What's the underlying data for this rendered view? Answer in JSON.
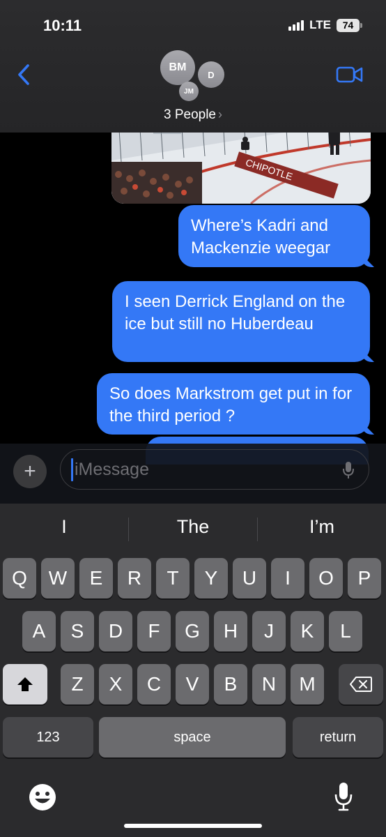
{
  "status_bar": {
    "time": "10:11",
    "network": "LTE",
    "battery": "74"
  },
  "header": {
    "avatars": [
      "BM",
      "D",
      "JM"
    ],
    "title": "3 People"
  },
  "messages": [
    {
      "text": "Where’s Kadri and Mackenzie weegar"
    },
    {
      "text": "I seen Derrick England on the ice but still no Huberdeau"
    },
    {
      "text": "So does Markstrom get put in for the third period ?"
    },
    {
      "text": ""
    }
  ],
  "photo": {
    "board_text": "CHIPOTLE"
  },
  "composer": {
    "placeholder": "iMessage",
    "plus": "+"
  },
  "keyboard": {
    "suggestions": [
      "I",
      "The",
      "I’m"
    ],
    "row1": [
      "Q",
      "W",
      "E",
      "R",
      "T",
      "Y",
      "U",
      "I",
      "O",
      "P"
    ],
    "row2": [
      "A",
      "S",
      "D",
      "F",
      "G",
      "H",
      "J",
      "K",
      "L"
    ],
    "row3": [
      "Z",
      "X",
      "C",
      "V",
      "B",
      "N",
      "M"
    ],
    "numbers": "123",
    "space": "space",
    "return": "return"
  },
  "colors": {
    "bubble": "#3478f6",
    "accent": "#3478f6",
    "background": "#000000"
  }
}
